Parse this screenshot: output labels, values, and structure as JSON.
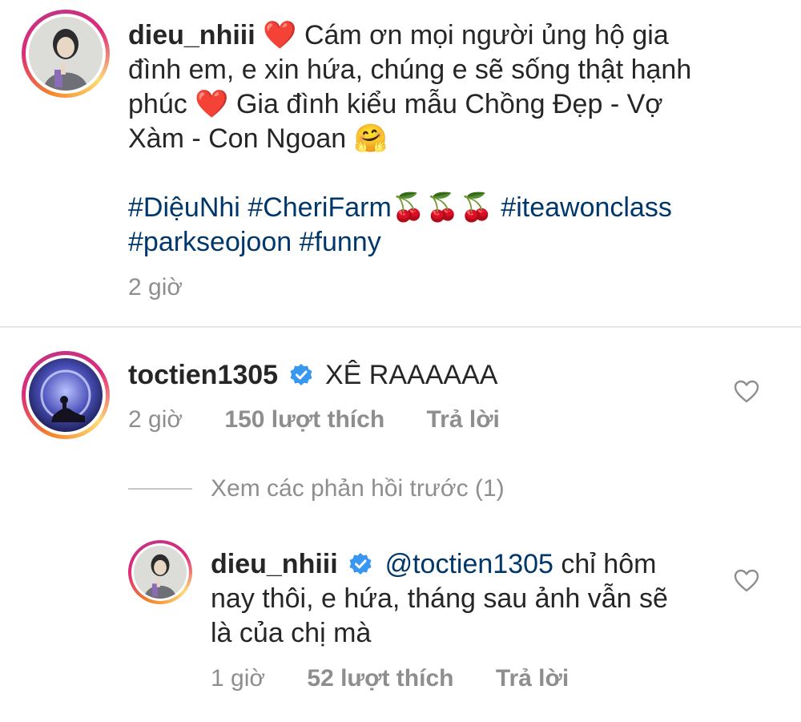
{
  "post": {
    "username": "dieu_nhiii",
    "caption_lines": [
      "Cám ơn mọi người ủng hộ gia",
      "đình em, e xin hứa, chúng e sẽ sống thật hạnh",
      "phúc",
      "Gia đình kiểu mẫu Chồng Đẹp - Vợ",
      "Xàm - Con Ngoan"
    ],
    "hashtags": {
      "dieunhi": "#DiệuNhi",
      "cherifarm": "#CheriFarm",
      "iteawonclass": "#iteawonclass",
      "parkseojoon": "#parkseojoon",
      "funny": "#funny"
    },
    "time": "2 giờ",
    "heart_emoji": "❤️",
    "hug_emoji": "🤗",
    "cherry_emoji": "🍒"
  },
  "comment1": {
    "username": "toctien1305",
    "text": "XÊ RAAAAAA",
    "time": "2 giờ",
    "likes": "150 lượt thích",
    "reply": "Trả lời"
  },
  "view_replies": "Xem các phản hồi trước (1)",
  "reply1": {
    "username": "dieu_nhiii",
    "mention": "@toctien1305",
    "text_line1": "chỉ hôm",
    "text_line2": "nay thôi, e hứa, tháng sau ảnh vẫn sẽ",
    "text_line3": "là của chị mà",
    "time": "1 giờ",
    "likes": "52 lượt thích",
    "reply": "Trả lời"
  },
  "colors": {
    "text": "#262626",
    "hashtag": "#00376b",
    "meta": "#8e8e8e",
    "verified": "#3897f0",
    "heart": "#e0245e"
  }
}
